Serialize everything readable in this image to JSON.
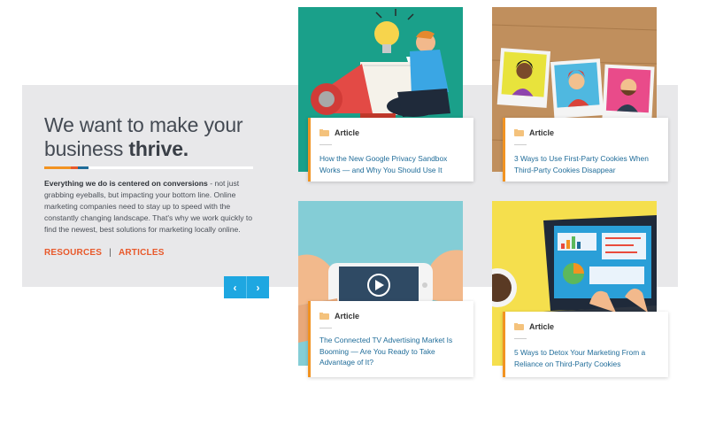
{
  "intro": {
    "headline_regular": "We want to make your business ",
    "headline_bold": "thrive.",
    "body_bold": "Everything we do is centered on conversions",
    "body_rest": " - not just grabbing eyeballs, but impacting your bottom line. Online marketing companies need to stay up to speed with the constantly changing landscape. That's why we work quickly to find the newest, best solutions for marketing locally online."
  },
  "links": {
    "resources": "RESOURCES",
    "separator": "|",
    "articles": "ARTICLES"
  },
  "carousel": {
    "prev_icon": "chevron-left-icon",
    "next_icon": "chevron-right-icon",
    "prev_glyph": "‹",
    "next_glyph": "›"
  },
  "articles": [
    {
      "tag": "Article",
      "title": "How the New Google Privacy Sandbox Works — and Why You Should Use It",
      "image_icon": "megaphone-illustration"
    },
    {
      "tag": "Article",
      "title": "3 Ways to Use First-Party Cookies When Third-Party Cookies Disappear",
      "image_icon": "polaroid-photos-illustration"
    },
    {
      "tag": "Article",
      "title": "The Connected TV Advertising Market Is Booming — Are You Ready to Take Advantage of It?",
      "image_icon": "phone-video-illustration"
    },
    {
      "tag": "Article",
      "title": "5 Ways to Detox Your Marketing From a Reliance on Third-Party Cookies",
      "image_icon": "laptop-analytics-illustration"
    }
  ],
  "colors": {
    "accent_orange": "#e8592b",
    "card_border": "#f29321",
    "nav_blue": "#1ea7e1",
    "link_blue": "#1f6c99",
    "panel_gray": "#e8e8ea"
  }
}
